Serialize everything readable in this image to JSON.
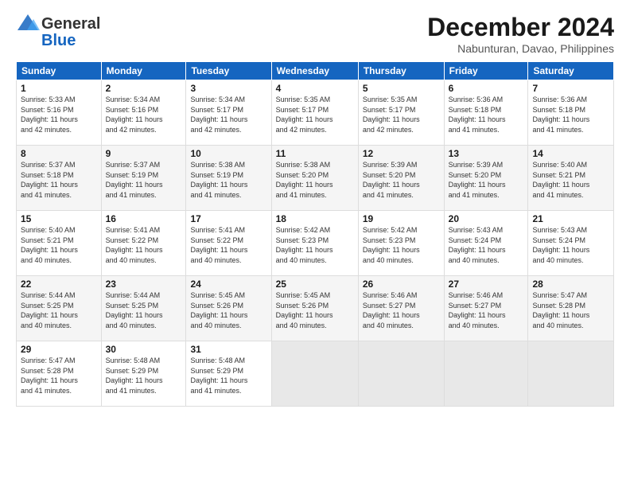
{
  "logo": {
    "general": "General",
    "blue": "Blue"
  },
  "header": {
    "title": "December 2024",
    "location": "Nabunturan, Davao, Philippines"
  },
  "weekdays": [
    "Sunday",
    "Monday",
    "Tuesday",
    "Wednesday",
    "Thursday",
    "Friday",
    "Saturday"
  ],
  "weeks": [
    [
      {
        "day": "1",
        "info": "Sunrise: 5:33 AM\nSunset: 5:16 PM\nDaylight: 11 hours\nand 42 minutes."
      },
      {
        "day": "2",
        "info": "Sunrise: 5:34 AM\nSunset: 5:16 PM\nDaylight: 11 hours\nand 42 minutes."
      },
      {
        "day": "3",
        "info": "Sunrise: 5:34 AM\nSunset: 5:17 PM\nDaylight: 11 hours\nand 42 minutes."
      },
      {
        "day": "4",
        "info": "Sunrise: 5:35 AM\nSunset: 5:17 PM\nDaylight: 11 hours\nand 42 minutes."
      },
      {
        "day": "5",
        "info": "Sunrise: 5:35 AM\nSunset: 5:17 PM\nDaylight: 11 hours\nand 42 minutes."
      },
      {
        "day": "6",
        "info": "Sunrise: 5:36 AM\nSunset: 5:18 PM\nDaylight: 11 hours\nand 41 minutes."
      },
      {
        "day": "7",
        "info": "Sunrise: 5:36 AM\nSunset: 5:18 PM\nDaylight: 11 hours\nand 41 minutes."
      }
    ],
    [
      {
        "day": "8",
        "info": "Sunrise: 5:37 AM\nSunset: 5:18 PM\nDaylight: 11 hours\nand 41 minutes."
      },
      {
        "day": "9",
        "info": "Sunrise: 5:37 AM\nSunset: 5:19 PM\nDaylight: 11 hours\nand 41 minutes."
      },
      {
        "day": "10",
        "info": "Sunrise: 5:38 AM\nSunset: 5:19 PM\nDaylight: 11 hours\nand 41 minutes."
      },
      {
        "day": "11",
        "info": "Sunrise: 5:38 AM\nSunset: 5:20 PM\nDaylight: 11 hours\nand 41 minutes."
      },
      {
        "day": "12",
        "info": "Sunrise: 5:39 AM\nSunset: 5:20 PM\nDaylight: 11 hours\nand 41 minutes."
      },
      {
        "day": "13",
        "info": "Sunrise: 5:39 AM\nSunset: 5:20 PM\nDaylight: 11 hours\nand 41 minutes."
      },
      {
        "day": "14",
        "info": "Sunrise: 5:40 AM\nSunset: 5:21 PM\nDaylight: 11 hours\nand 41 minutes."
      }
    ],
    [
      {
        "day": "15",
        "info": "Sunrise: 5:40 AM\nSunset: 5:21 PM\nDaylight: 11 hours\nand 40 minutes."
      },
      {
        "day": "16",
        "info": "Sunrise: 5:41 AM\nSunset: 5:22 PM\nDaylight: 11 hours\nand 40 minutes."
      },
      {
        "day": "17",
        "info": "Sunrise: 5:41 AM\nSunset: 5:22 PM\nDaylight: 11 hours\nand 40 minutes."
      },
      {
        "day": "18",
        "info": "Sunrise: 5:42 AM\nSunset: 5:23 PM\nDaylight: 11 hours\nand 40 minutes."
      },
      {
        "day": "19",
        "info": "Sunrise: 5:42 AM\nSunset: 5:23 PM\nDaylight: 11 hours\nand 40 minutes."
      },
      {
        "day": "20",
        "info": "Sunrise: 5:43 AM\nSunset: 5:24 PM\nDaylight: 11 hours\nand 40 minutes."
      },
      {
        "day": "21",
        "info": "Sunrise: 5:43 AM\nSunset: 5:24 PM\nDaylight: 11 hours\nand 40 minutes."
      }
    ],
    [
      {
        "day": "22",
        "info": "Sunrise: 5:44 AM\nSunset: 5:25 PM\nDaylight: 11 hours\nand 40 minutes."
      },
      {
        "day": "23",
        "info": "Sunrise: 5:44 AM\nSunset: 5:25 PM\nDaylight: 11 hours\nand 40 minutes."
      },
      {
        "day": "24",
        "info": "Sunrise: 5:45 AM\nSunset: 5:26 PM\nDaylight: 11 hours\nand 40 minutes."
      },
      {
        "day": "25",
        "info": "Sunrise: 5:45 AM\nSunset: 5:26 PM\nDaylight: 11 hours\nand 40 minutes."
      },
      {
        "day": "26",
        "info": "Sunrise: 5:46 AM\nSunset: 5:27 PM\nDaylight: 11 hours\nand 40 minutes."
      },
      {
        "day": "27",
        "info": "Sunrise: 5:46 AM\nSunset: 5:27 PM\nDaylight: 11 hours\nand 40 minutes."
      },
      {
        "day": "28",
        "info": "Sunrise: 5:47 AM\nSunset: 5:28 PM\nDaylight: 11 hours\nand 40 minutes."
      }
    ],
    [
      {
        "day": "29",
        "info": "Sunrise: 5:47 AM\nSunset: 5:28 PM\nDaylight: 11 hours\nand 41 minutes."
      },
      {
        "day": "30",
        "info": "Sunrise: 5:48 AM\nSunset: 5:29 PM\nDaylight: 11 hours\nand 41 minutes."
      },
      {
        "day": "31",
        "info": "Sunrise: 5:48 AM\nSunset: 5:29 PM\nDaylight: 11 hours\nand 41 minutes."
      },
      null,
      null,
      null,
      null
    ]
  ]
}
